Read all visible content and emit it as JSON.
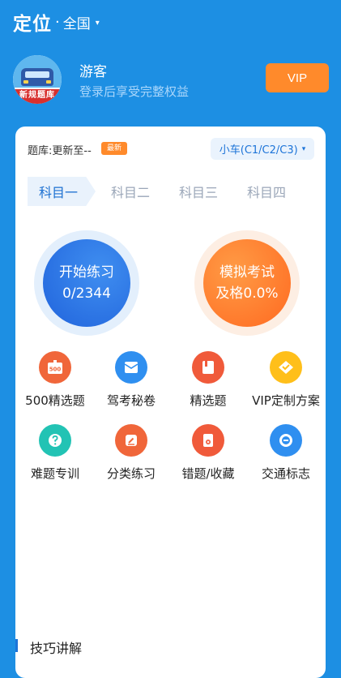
{
  "header": {
    "title": "定位",
    "dot": "·",
    "region": "全国",
    "caret": "▾"
  },
  "user": {
    "name": "游客",
    "subtitle": "登录后享受完整权益",
    "avatar_text": "新规题库",
    "vip_label": "VIP"
  },
  "bank": {
    "label": "题库:更新至--",
    "badge": "最新",
    "car_type": "小车(C1/C2/C3)",
    "caret": "▾"
  },
  "tabs": [
    "科目一",
    "科目二",
    "科目三",
    "科目四"
  ],
  "practice": {
    "title": "开始练习",
    "progress": "0/2344"
  },
  "exam": {
    "title": "模拟考试",
    "pass_rate": "及格0.0%"
  },
  "grid": [
    {
      "label": "500精选题",
      "icon": "500-icon",
      "color": "#f0663a",
      "badge": "500"
    },
    {
      "label": "驾考秘卷",
      "icon": "envelope-icon",
      "color": "#2f8ff0"
    },
    {
      "label": "精选题",
      "icon": "book-icon",
      "color": "#f05a3a"
    },
    {
      "label": "VIP定制方案",
      "icon": "diamond-icon",
      "color": "#ffbf1a"
    },
    {
      "label": "难题专训",
      "icon": "question-icon",
      "color": "#22c3b4"
    },
    {
      "label": "分类练习",
      "icon": "pencil-icon",
      "color": "#f0663a"
    },
    {
      "label": "错题/收藏",
      "icon": "wrong-book-icon",
      "color": "#f05a3a"
    },
    {
      "label": "交通标志",
      "icon": "sign-icon",
      "color": "#2f8ff0"
    }
  ],
  "tips": {
    "title": "技巧讲解"
  }
}
